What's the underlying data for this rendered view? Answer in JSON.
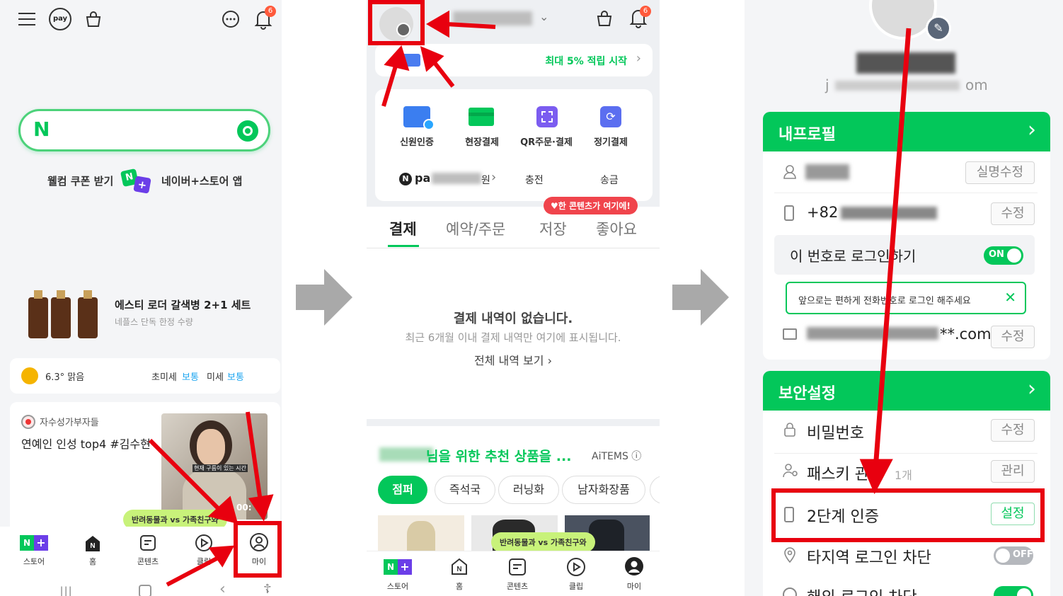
{
  "p1": {
    "pay_badge": "pay",
    "notif_count": "6",
    "search_logo": "N",
    "welcome_text": "웰컴 쿠폰 받기",
    "store_app": "네이버+스토어 앱",
    "product_title": "에스티 로더 갈색병 2+1 세트",
    "product_sub": "네플스 단독 한정 수량",
    "weather_temp": "6.3° 맑음",
    "dust_fine_label": "초미세",
    "dust_fine_value": "보통",
    "dust_label": "미세",
    "dust_value": "보통",
    "content_source": "자수성가부자들",
    "content_title": "연예인 인성 top4 #김수현",
    "video_time": "00:",
    "photo_caption": "현재 구름이 있는 시간",
    "bubble": "반려동물과 vs 가족친구와",
    "nav": [
      "스토어",
      "홈",
      "콘텐츠",
      "클립",
      "마이"
    ],
    "nplus_n": "N",
    "nplus_plus": "+"
  },
  "p2": {
    "notif_count": "6",
    "benefit": "최대 5% 적립 시작",
    "actions": [
      "신원인증",
      "현장결제",
      "QR주문·결제",
      "정기결제"
    ],
    "pay_prefix": "pa",
    "pay_suffix": "원",
    "charge": "충전",
    "send": "송금",
    "promo": "♥한 콘텐츠가 여기에!",
    "tabs": [
      "결제",
      "예약/주문",
      "저장",
      "좋아요"
    ],
    "empty_title": "결제 내역이 없습니다.",
    "empty_sub": "최근 6개월 이내 결제 내역만 여기에 표시됩니다.",
    "empty_link": "전체 내역 보기",
    "rec_title": "님을 위한 추천 상품을 ...",
    "aitems": "AiTEMS",
    "chips": [
      "점퍼",
      "즉석국",
      "러닝화",
      "남자화장품"
    ],
    "bubble": "반려동물과 vs 가족친구와",
    "nav": [
      "스토어",
      "홈",
      "콘텐츠",
      "클립",
      "마이"
    ],
    "nplus_n": "N",
    "nplus_plus": "+"
  },
  "p3": {
    "email_prefix": "j",
    "email_suffix": "om",
    "profile_header": "내프로필",
    "name_edit": "실명수정",
    "phone_prefix": "+82",
    "edit": "수정",
    "phone_login": "이 번호로 로그인하기",
    "on": "ON",
    "tooltip": "앞으로는 편하게 전화번호로 로그인 해주세요",
    "email_row_suffix": "**.com",
    "security_header": "보안설정",
    "password": "비밀번호",
    "passkey": "패스키 관리",
    "passkey_count": "1개",
    "manage": "관리",
    "two_factor": "2단계 인증",
    "setup": "설정",
    "block_region": "타지역 로그인 차단",
    "off": "OFF",
    "block_overseas": "해외 로그인 차단"
  },
  "colors": {
    "naver_green": "#03c75a",
    "annotation_red": "#e8000f",
    "arrow_gray": "#a9a9a9"
  }
}
